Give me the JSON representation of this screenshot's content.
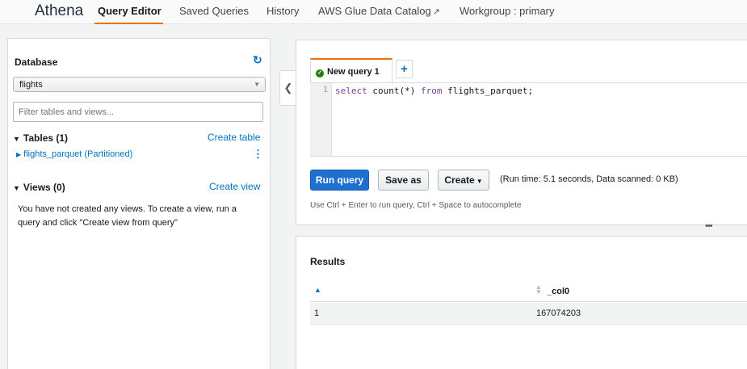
{
  "nav": {
    "brand": "Athena",
    "items": [
      "Query Editor",
      "Saved Queries",
      "History",
      "AWS Glue Data Catalog",
      "Workgroup : primary"
    ],
    "active": "Query Editor"
  },
  "sidebar": {
    "database_label": "Database",
    "database_value": "flights",
    "filter_placeholder": "Filter tables and views...",
    "tables_label": "Tables (1)",
    "create_table": "Create table",
    "tables": [
      "flights_parquet (Partitioned)"
    ],
    "views_label": "Views (0)",
    "create_view": "Create view",
    "views_message": "You have not created any views. To create a view, run a query and click \"Create view from query\""
  },
  "editor": {
    "tab_label": "New query 1",
    "add_tab": "+",
    "line_number": "1",
    "query": {
      "kw_select": "select",
      "mid": " count(*) ",
      "kw_from": "from",
      "rest": " flights_parquet;"
    },
    "run_label": "Run query",
    "save_label": "Save as",
    "create_label": "Create",
    "runtime": "(Run time: 5.1 seconds, Data scanned: 0 KB)",
    "hint": "Use Ctrl + Enter to run query, Ctrl + Space to autocomplete"
  },
  "results": {
    "title": "Results",
    "columns": [
      "",
      "_col0"
    ],
    "rows": [
      [
        "1",
        "167074203"
      ]
    ]
  },
  "colors": {
    "accent": "#ec7211",
    "link": "#0073bb",
    "primary_button": "#1f6fd0",
    "success": "#1d8102"
  }
}
